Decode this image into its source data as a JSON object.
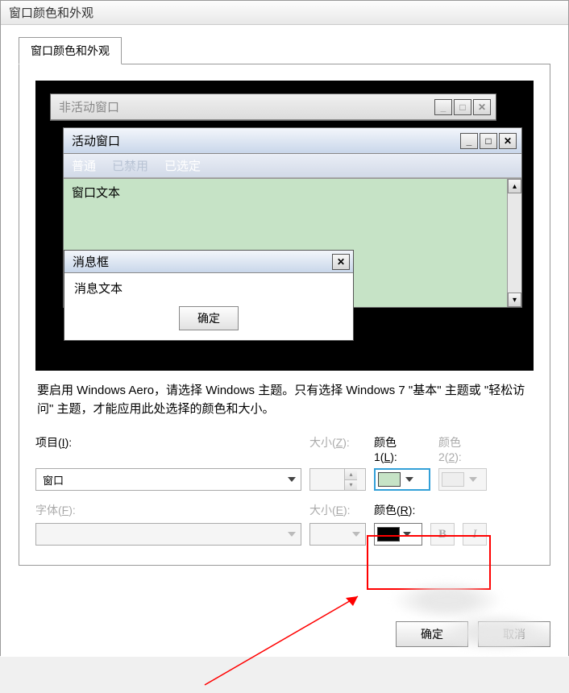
{
  "outer_title": "窗口颜色和外观",
  "tab_label": "窗口颜色和外观",
  "preview": {
    "inactive_title": "非活动窗口",
    "active_title": "活动窗口",
    "menu": {
      "normal": "普通",
      "disabled": "已禁用",
      "selected": "已选定"
    },
    "window_text": "窗口文本",
    "msgbox_title": "消息框",
    "msgbox_text": "消息文本",
    "msgbox_ok": "确定",
    "winbtn_min": "_",
    "winbtn_max": "□",
    "winbtn_close": "✕",
    "scroll_up": "▴",
    "scroll_down": "▾"
  },
  "info_text": "要启用 Windows Aero，请选择 Windows 主题。只有选择 Windows 7 \"基本\" 主题或 \"轻松访问\" 主题，才能应用此处选择的颜色和大小。",
  "labels": {
    "item": "项目(I):",
    "size1": "大小(Z):",
    "color1_a": "颜色",
    "color1_b": "1(L):",
    "color2_a": "颜色",
    "color2_b": "2(2):",
    "font": "字体(F):",
    "size2": "大小(E):",
    "color_r": "颜色(R):",
    "bold": "B",
    "italic": "I"
  },
  "values": {
    "item_selected": "窗口",
    "size1_value": "",
    "size2_value": "",
    "font_value": "",
    "color1_hex": "#c6e3c6",
    "color2_hex": "",
    "color_r_hex": "#000000"
  },
  "buttons": {
    "ok": "确定",
    "cancel": "取消"
  }
}
